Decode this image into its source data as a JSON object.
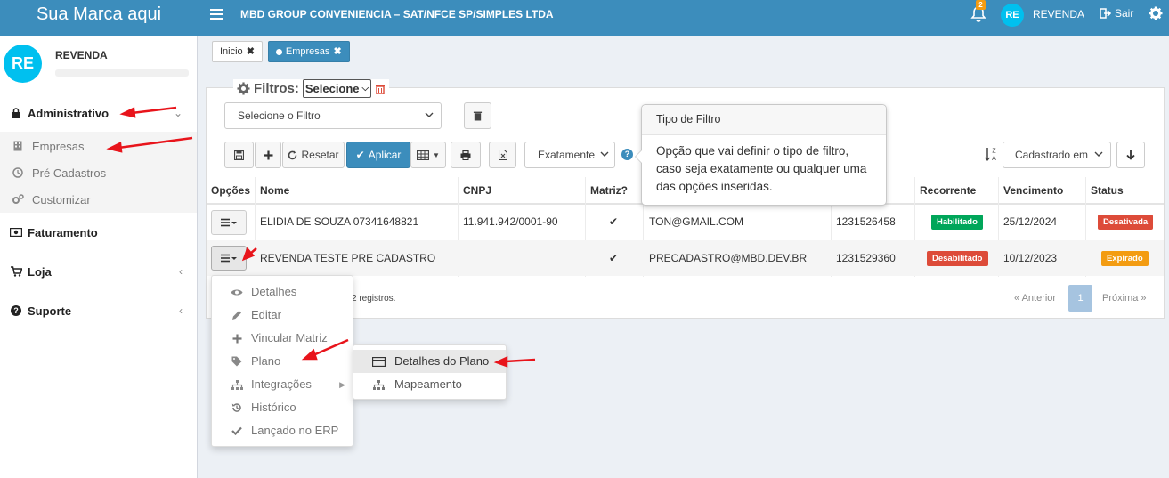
{
  "header": {
    "brand": "Sua Marca aqui",
    "company": "MBD GROUP CONVENIENCIA – SAT/NFCE SP/SIMPLES LTDA",
    "notifications_count": "2",
    "avatar_initials": "RE",
    "user_name": "REVENDA",
    "logout_label": "Sair"
  },
  "sidebar": {
    "avatar_initials": "RE",
    "user_name": "REVENDA",
    "items": [
      {
        "label": "Administrativo",
        "icon": "lock-icon"
      },
      {
        "label": "Faturamento",
        "icon": "money-icon"
      },
      {
        "label": "Loja",
        "icon": "cart-icon"
      },
      {
        "label": "Suporte",
        "icon": "question-circle-icon"
      }
    ],
    "subitems": [
      {
        "label": "Empresas",
        "icon": "building-icon"
      },
      {
        "label": "Pré Cadastros",
        "icon": "clock-icon"
      },
      {
        "label": "Customizar",
        "icon": "cogs-icon"
      }
    ]
  },
  "tabs": [
    {
      "label": "Inicio"
    },
    {
      "label": "Empresas"
    }
  ],
  "filters": {
    "title": "Filtros:",
    "selector_value": "Selecione",
    "filter_select_placeholder": "Selecione o Filtro",
    "reset_label": "Resetar",
    "apply_label": "Aplicar",
    "match_value": "Exatamente",
    "sort_value": "Cadastrado em"
  },
  "tooltip": {
    "title": "Tipo de Filtro",
    "body": "Opção que vai definir o tipo de filtro, caso seja exatamente ou qualquer uma das opções inseridas."
  },
  "table": {
    "headers": [
      "Opções",
      "Nome",
      "CNPJ",
      "Matriz?",
      "",
      "",
      "Recorrente",
      "Vencimento",
      "Status"
    ],
    "rows": [
      {
        "nome": "ELIDIA DE SOUZA 07341648821",
        "cnpj": "11.941.942/0001-90",
        "matriz": "✔",
        "email": "TON@GMAIL.COM",
        "codigo": "1231526458",
        "recorrente": "Habilitado",
        "vencimento": "25/12/2024",
        "status": "Desativada"
      },
      {
        "nome": "REVENDA TESTE PRE CADASTRO",
        "cnpj": "",
        "matriz": "✔",
        "email": "PRECADASTRO@MBD.DEV.BR",
        "codigo": "1231529360",
        "recorrente": "Desabilitado",
        "vencimento": "10/12/2023",
        "status": "Expirado"
      }
    ],
    "footer_text": "2 registros.",
    "prev_label": "« Anterior",
    "page": "1",
    "next_label": "Próxima »"
  },
  "context_menu": {
    "items": [
      {
        "label": "Detalhes",
        "icon": "eye-icon"
      },
      {
        "label": "Editar",
        "icon": "pencil-icon"
      },
      {
        "label": "Vincular Matriz",
        "icon": "plus-icon"
      },
      {
        "label": "Plano",
        "icon": "tag-icon"
      },
      {
        "label": "Integrações",
        "icon": "sitemap-icon"
      },
      {
        "label": "Histórico",
        "icon": "history-icon"
      },
      {
        "label": "Lançado no ERP",
        "icon": "check-icon"
      }
    ],
    "submenu": [
      {
        "label": "Detalhes do Plano",
        "icon": "credit-card-icon"
      },
      {
        "label": "Mapeamento",
        "icon": "sitemap-icon"
      }
    ]
  },
  "colors": {
    "primary": "#3c8dbc",
    "avatar": "#00c0ef",
    "success": "#00a65a",
    "danger": "#dd4b39",
    "warning": "#f39c12",
    "annotation_arrow": "#e8141b"
  }
}
